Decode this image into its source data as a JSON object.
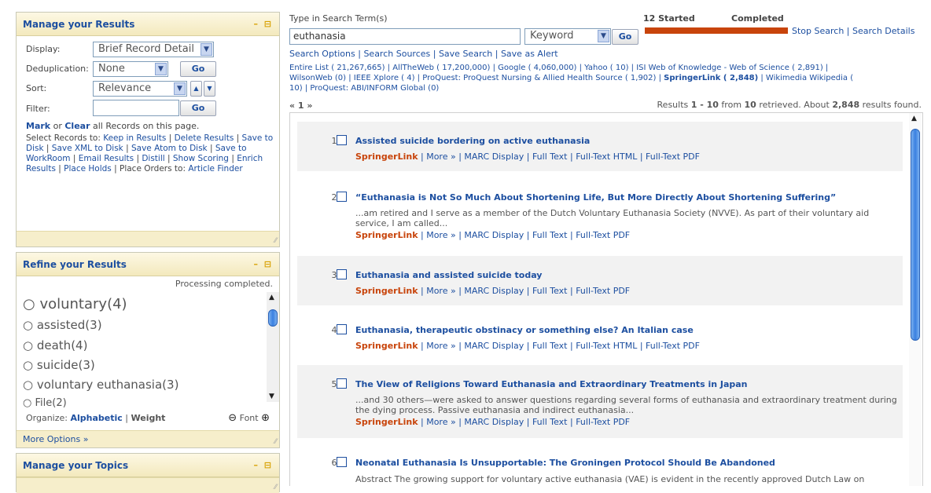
{
  "manage_results": {
    "title": "Manage your Results",
    "display_label": "Display:",
    "display_value": "Brief Record Detail",
    "dedup_label": "Deduplication:",
    "dedup_value": "None",
    "go": "Go",
    "sort_label": "Sort:",
    "sort_value": "Relevance",
    "filter_label": "Filter:",
    "filter_value": "",
    "mark": "Mark",
    "or": " or ",
    "clear": "Clear",
    "mark_rest": " all Records on this page.",
    "select_prefix": "Select Records to: ",
    "actions": [
      "Keep in Results",
      "Delete Results",
      "Save to Disk",
      "Save XML to Disk",
      "Save Atom to Disk",
      "Save to WorkRoom",
      "Email Results",
      "Distill",
      "Show Scoring",
      "Enrich Results",
      "Place Holds"
    ],
    "place_orders": "Place Orders to:",
    "article_finder": "Article Finder"
  },
  "refine": {
    "title": "Refine your Results",
    "status": "Processing completed.",
    "facets": [
      {
        "term": "voluntary",
        "count": "(4)"
      },
      {
        "term": "assisted",
        "count": "(3)"
      },
      {
        "term": "death",
        "count": "(4)"
      },
      {
        "term": "suicide",
        "count": "(3)"
      },
      {
        "term": "voluntary euthanasia",
        "count": "(3)"
      },
      {
        "term": "File",
        "count": "(2)"
      }
    ],
    "organize_label": "Organize:",
    "alphabetic": "Alphabetic",
    "weight": "Weight",
    "font_label": "Font",
    "more_options": "More Options »"
  },
  "topics": {
    "title": "Manage your Topics"
  },
  "search": {
    "label": "Type in Search Term(s)",
    "term": "euthanasia",
    "field": "Keyword",
    "go": "Go",
    "started": "12 Started",
    "completed": "Completed",
    "stop": "Stop Search",
    "details": "Search Details",
    "options": [
      "Search Options",
      "Search Sources",
      "Save Search",
      "Save as Alert"
    ]
  },
  "sources_line1": "Entire List ( 21,267,665) | AllTheWeb ( 17,200,000) | Google ( 4,060,000) | Yahoo ( 10) | ISI Web of Knowledge - Web of Science ( 2,891) |",
  "sources_line2_a": "WilsonWeb (0) | IEEE Xplore ( 4) | ProQuest: ProQuest Nursing & Allied Health Source ( 1,902) | ",
  "sources_line2_b": "SpringerLink ( 2,848)",
  "sources_line2_c": " | Wikimedia Wikipedia (",
  "sources_line3": "10) | ProQuest: ABI/INFORM Global (0)",
  "pager": "« 1 »",
  "results_summary": {
    "prefix": "Results ",
    "range": "1 - 10",
    "mid": " from ",
    "total": "10",
    "mid2": " retrieved. About ",
    "found": "2,848",
    "suffix": " results found."
  },
  "results": [
    {
      "num": "1.",
      "title": "Assisted suicide bordering on active euthanasia",
      "snippet": "",
      "links": "SpringerLink",
      "rest": " | More » | MARC Display | Full Text | Full-Text HTML | Full-Text PDF"
    },
    {
      "num": "2.",
      "title": "“Euthanasia is Not So Much About Shortening Life, But More Directly About Shortening Suffering”",
      "snippet": "...am retired and I serve as a member of the Dutch Voluntary Euthanasia Society (NVVE). As part of their voluntary aid service, I am called...",
      "links": "SpringerLink",
      "rest": " | More » | MARC Display | Full Text | Full-Text PDF"
    },
    {
      "num": "3.",
      "title": "Euthanasia and assisted suicide today",
      "snippet": "",
      "links": "SpringerLink",
      "rest": " | More » | MARC Display | Full Text | Full-Text PDF"
    },
    {
      "num": "4.",
      "title": "Euthanasia, therapeutic obstinacy or something else? An Italian case",
      "snippet": "",
      "links": "SpringerLink",
      "rest": " | More » | MARC Display | Full Text | Full-Text HTML | Full-Text PDF"
    },
    {
      "num": "5.",
      "title": "The View of Religions Toward Euthanasia and Extraordinary Treatments in Japan",
      "snippet": "...and 30 others—were asked to answer questions regarding several forms of euthanasia and extraordinary treatment during the dying process. Passive euthanasia and indirect euthanasia...",
      "links": "SpringerLink",
      "rest": " | More » | MARC Display | Full Text | Full-Text PDF"
    },
    {
      "num": "6.",
      "title": "Neonatal Euthanasia Is Unsupportable: The Groningen Protocol Should Be Abandoned",
      "snippet": "Abstract   The growing support for voluntary active euthanasia (VAE) is evident in the recently approved Dutch Law on",
      "links": "",
      "rest": ""
    }
  ],
  "colors": {
    "accent": "#1d4fa0",
    "source": "#c8440b",
    "progress": "#c8440b",
    "panel_head": "#f3e9bd"
  }
}
